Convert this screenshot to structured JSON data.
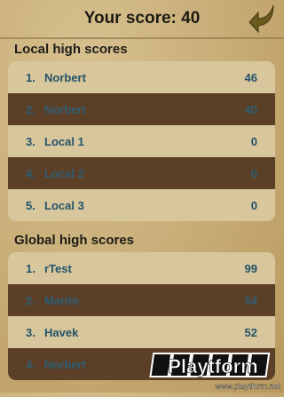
{
  "header": {
    "title": "Your score: 40"
  },
  "local": {
    "title": "Local high scores",
    "rows": [
      {
        "rank": "1.",
        "name": "Norbert",
        "score": "46"
      },
      {
        "rank": "2.",
        "name": "Norbert",
        "score": "40"
      },
      {
        "rank": "3.",
        "name": "Local 1",
        "score": "0"
      },
      {
        "rank": "4.",
        "name": "Local 2",
        "score": "0"
      },
      {
        "rank": "5.",
        "name": "Local 3",
        "score": "0"
      }
    ]
  },
  "global": {
    "title": "Global high scores",
    "rows": [
      {
        "rank": "1.",
        "name": "rTest",
        "score": "99"
      },
      {
        "rank": "2.",
        "name": "Martin",
        "score": "54"
      },
      {
        "rank": "3.",
        "name": "Havek",
        "score": "52"
      },
      {
        "rank": "4.",
        "name": "Norbert",
        "score": ""
      }
    ]
  },
  "watermark": {
    "brand": "Playtform",
    "url": "www.playtform.net"
  }
}
